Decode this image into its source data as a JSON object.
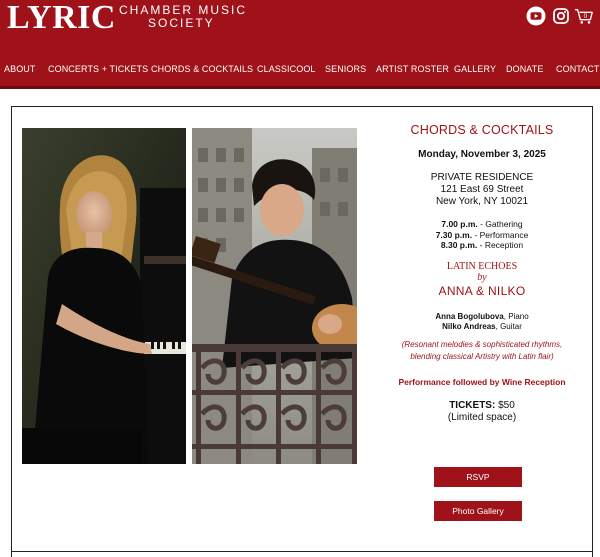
{
  "brand": {
    "logo_main": "LYRIC",
    "logo_line_1": "CHAMBER MUSIC",
    "logo_line_2": "SOCIETY"
  },
  "social": [
    "youtube-icon",
    "instagram-icon",
    "cart-icon"
  ],
  "cart_count": "0",
  "nav": [
    "ABOUT",
    "CONCERTS + TICKETS",
    "CHORDS & COCKTAILS",
    "CLASSICOOL",
    "SENIORS",
    "ARTIST ROSTER",
    "GALLERY",
    "DONATE",
    "CONTACT"
  ],
  "event": {
    "title": "CHORDS & COCKTAILS",
    "date": "Monday, November 3, 2025",
    "venue": "PRIVATE RESIDENCE",
    "address_1": "121 East 69 Street",
    "address_2": "New York, NY 10021",
    "schedule": [
      {
        "time": "7.00 p.m.",
        "label": " - Gathering"
      },
      {
        "time": "7.30 p.m.",
        "label": " -  Performance"
      },
      {
        "time": "8.30 p.m.",
        "label": " - Reception"
      }
    ],
    "program": "LATIN ECHOES",
    "by": "by",
    "artists": "ANNA & NILKO",
    "performers": [
      {
        "name": "Anna Bogolubova",
        "instrument": ", Piano"
      },
      {
        "name": "Nilko Andreas",
        "instrument": ", Guitar"
      }
    ],
    "blurb_1": "(Resonant melodies & sophisticated rhythms,",
    "blurb_2": "blending classical Artistry with Latin flair)",
    "followed_by": "Performance followed by Wine Reception",
    "tickets_label": "TICKETS:",
    "tickets_price": " $50",
    "limited": "(Limited space)"
  },
  "buttons": {
    "rsvp": "RSVP",
    "gallery": "Photo Gallery"
  },
  "colors": {
    "brand_red": "#a01219",
    "text_red": "#9c1117"
  }
}
